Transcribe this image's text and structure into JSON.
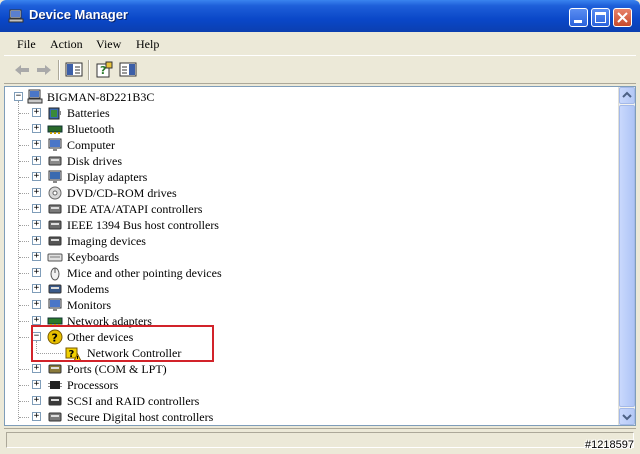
{
  "window": {
    "title": "Device Manager"
  },
  "menu": [
    "File",
    "Action",
    "View",
    "Help"
  ],
  "tree": {
    "root": "BIGMAN-8D221B3C",
    "categories": [
      {
        "label": "Batteries",
        "icon": "battery-icon"
      },
      {
        "label": "Bluetooth",
        "icon": "bluetooth-icon"
      },
      {
        "label": "Computer",
        "icon": "computer-icon"
      },
      {
        "label": "Disk drives",
        "icon": "disk-drive-icon"
      },
      {
        "label": "Display adapters",
        "icon": "display-adapter-icon"
      },
      {
        "label": "DVD/CD-ROM drives",
        "icon": "cdrom-icon"
      },
      {
        "label": "IDE ATA/ATAPI controllers",
        "icon": "ide-controller-icon"
      },
      {
        "label": "IEEE 1394 Bus host controllers",
        "icon": "ieee1394-icon"
      },
      {
        "label": "Imaging devices",
        "icon": "camera-icon"
      },
      {
        "label": "Keyboards",
        "icon": "keyboard-icon"
      },
      {
        "label": "Mice and other pointing devices",
        "icon": "mouse-icon"
      },
      {
        "label": "Modems",
        "icon": "modem-icon"
      },
      {
        "label": "Monitors",
        "icon": "monitor-icon"
      },
      {
        "label": "Network adapters",
        "icon": "network-adapter-icon"
      },
      {
        "label": "Other devices",
        "icon": "unknown-device-icon",
        "expanded": true,
        "children": [
          {
            "label": "Network Controller",
            "icon": "warning-device-icon"
          }
        ]
      },
      {
        "label": "Ports (COM & LPT)",
        "icon": "port-icon"
      },
      {
        "label": "Processors",
        "icon": "processor-icon"
      },
      {
        "label": "SCSI and RAID controllers",
        "icon": "scsi-icon"
      },
      {
        "label": "Secure Digital host controllers",
        "icon": "sd-controller-icon"
      }
    ]
  },
  "watermark": "#1218597",
  "colors": {
    "highlight": "#d2232a",
    "titlebar": "#0a47c8"
  }
}
